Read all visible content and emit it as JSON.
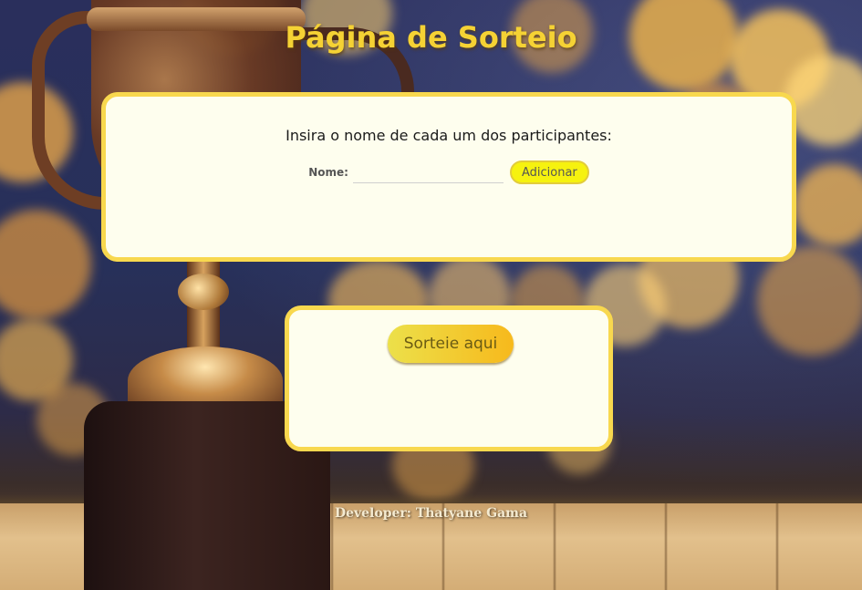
{
  "page": {
    "title": "Página de Sorteio"
  },
  "participants_card": {
    "instruction": "Insira o nome de cada um dos participantes:",
    "name_label": "Nome:",
    "name_value": "",
    "name_placeholder": "",
    "add_button_label": "Adicionar"
  },
  "draw_card": {
    "draw_button_label": "Sorteie aqui"
  },
  "footer": {
    "text": "Developer: Thatyane Gama"
  },
  "colors": {
    "title": "#f5d234",
    "card_background": "#fefeee",
    "card_border": "#f8d84e",
    "add_button": "#f6f20f",
    "draw_button_start": "#ece04a",
    "draw_button_end": "#f7b91c"
  },
  "background": {
    "icon": "trophy-icon"
  }
}
